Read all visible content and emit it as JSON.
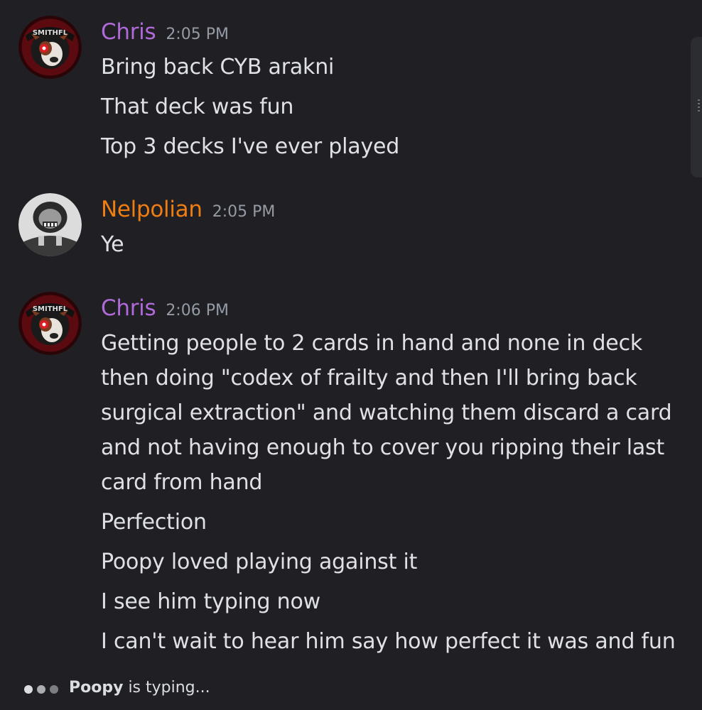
{
  "messages": [
    {
      "author": "Chris",
      "author_color": "#b06ad9",
      "avatar_icon": "smithfl-pitbull-avatar",
      "time": "2:05 PM",
      "lines": [
        "Bring back CYB arakni",
        "That deck was fun",
        "Top 3 decks I've ever played"
      ]
    },
    {
      "author": "Nelpolian",
      "author_color": "#ee7d12",
      "avatar_icon": "grayscale-helmet-figure-avatar",
      "time": "2:05 PM",
      "lines": [
        "Ye"
      ]
    },
    {
      "author": "Chris",
      "author_color": "#b06ad9",
      "avatar_icon": "smithfl-pitbull-avatar",
      "time": "2:06 PM",
      "lines": [
        "Getting people to 2 cards in hand and none in deck",
        "then doing \"codex of frailty and then I'll bring back",
        "surgical extraction\" and watching them discard a card",
        "and not having enough to cover you ripping their last",
        "card from hand",
        "Perfection",
        "Poopy loved playing against it",
        "I see him typing now",
        "I can't wait to hear him say how perfect it was and fun"
      ]
    }
  ],
  "typing": {
    "user": "Poopy",
    "suffix": " is typing..."
  }
}
